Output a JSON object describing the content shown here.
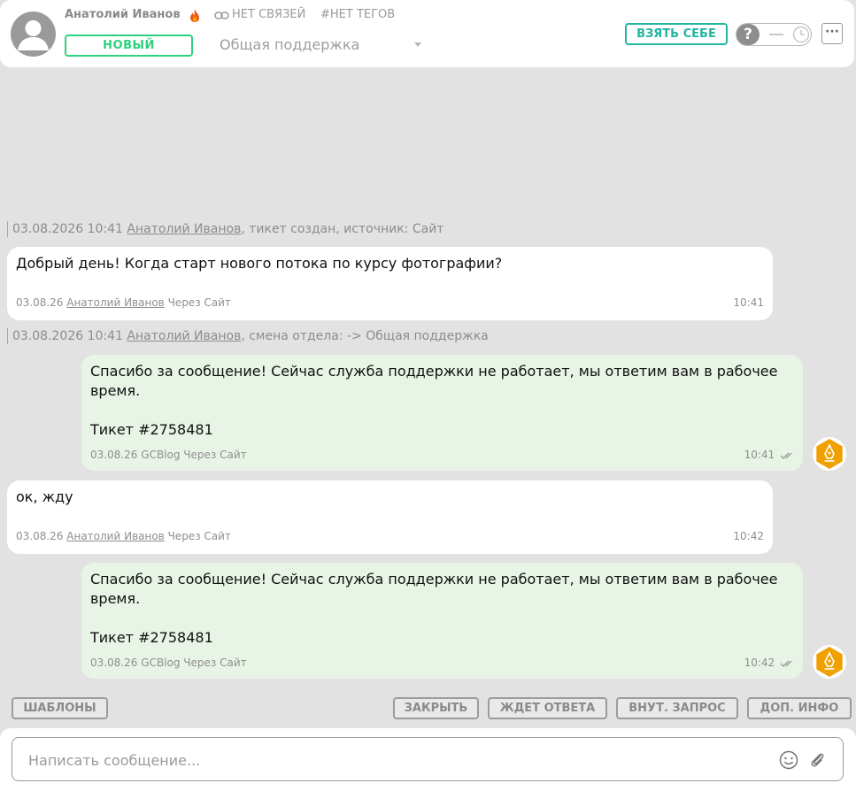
{
  "header": {
    "client_name": "Анатолий Иванов",
    "no_links": "НЕТ СВЯЗЕЙ",
    "no_tags": "#НЕТ ТЕГОВ",
    "status": "НОВЫЙ",
    "department": "Общая поддержка",
    "take_label": "ВЗЯТЬ СЕБЕ",
    "toggle_label": "?",
    "more_label": "···"
  },
  "events": [
    {
      "datetime": "03.08.2026 10:41",
      "author": "Анатолий Иванов",
      "text": ", тикет создан, источник: Сайт"
    },
    {
      "datetime": "03.08.2026 10:41",
      "author": "Анатолий Иванов",
      "text": ", смена отдела: -> Общая поддержка"
    }
  ],
  "messages": [
    {
      "direction": "in",
      "text": "Добрый день! Когда старт нового потока по курсу фотографии?",
      "date": "03.08.26",
      "author": "Анатолий Иванов",
      "via": "Через Сайт",
      "time": "10:41"
    },
    {
      "direction": "out",
      "text": "Спасибо за сообщение! Сейчас служба поддержки не работает, мы ответим вам в рабочее время.\n\nТикет #2758481",
      "date": "03.08.26",
      "author": "GCBlog",
      "via": "Через Сайт",
      "time": "10:41"
    },
    {
      "direction": "in",
      "text": "ок, жду",
      "date": "03.08.26",
      "author": "Анатолий Иванов",
      "via": "Через Сайт",
      "time": "10:42"
    },
    {
      "direction": "out",
      "text": "Спасибо за сообщение! Сейчас служба поддержки не работает, мы ответим вам в рабочее время.\n\nТикет #2758481",
      "date": "03.08.26",
      "author": "GCBlog",
      "via": "Через Сайт",
      "time": "10:42"
    }
  ],
  "actions": {
    "templates": "ШАБЛОНЫ",
    "close": "ЗАКРЫТЬ",
    "awaiting": "ЖДЕТ ОТВЕТА",
    "internal": "ВНУТ. ЗАПРОС",
    "more_info": "ДОП. ИНФО"
  },
  "composer": {
    "placeholder": "Написать сообщение..."
  },
  "icons": {
    "fire": "fire-icon",
    "link": "link-icon",
    "clock": "clock-icon",
    "emoji": "emoji-icon",
    "attach": "paperclip-icon",
    "bot": "bot-avatar-icon"
  },
  "colors": {
    "status_green": "#2ed17d",
    "take_teal": "#21b6a0",
    "out_bubble": "#e8f4e6",
    "bot_orange": "#f0a000"
  }
}
